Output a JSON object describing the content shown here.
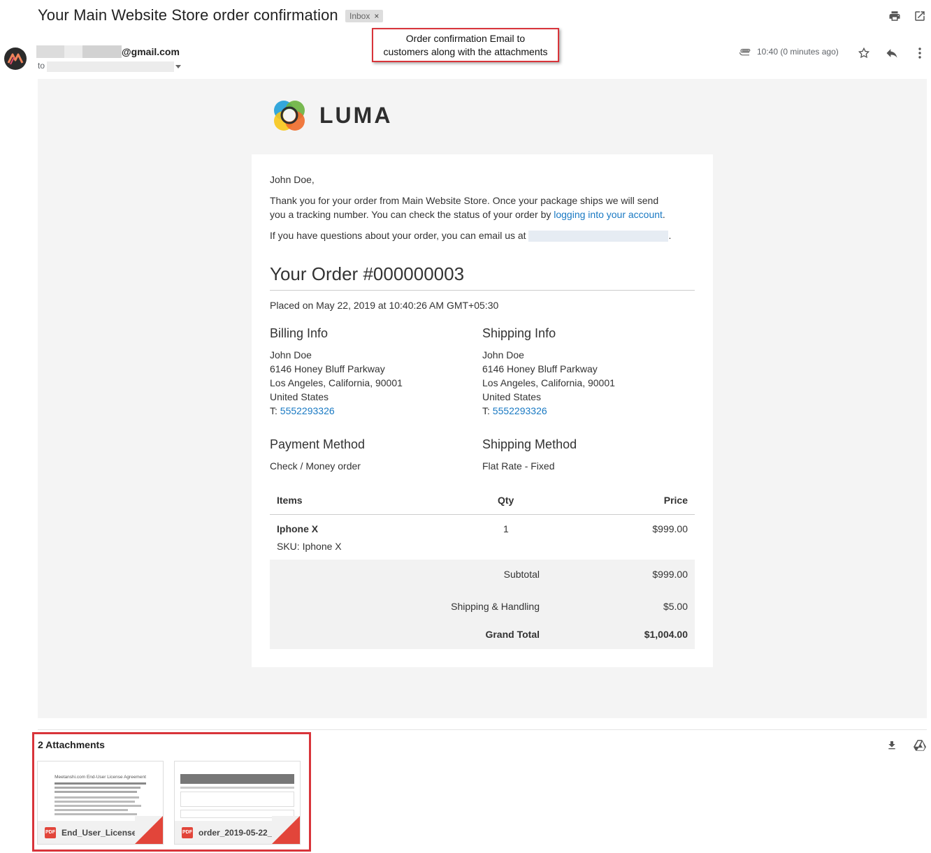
{
  "email": {
    "subject": "Your Main Website Store order confirmation",
    "label": "Inbox",
    "label_close": "×",
    "sender_domain": "@gmail.com",
    "to_label": "to",
    "time": "10:40 (0 minutes ago)"
  },
  "callout": {
    "line1": "Order confirmation Email to",
    "line2": "customers along with the attachments"
  },
  "store": {
    "logo_text": "LUMA"
  },
  "message": {
    "greeting": "John Doe,",
    "thanks_part1": "Thank you for your order from Main Website Store. Once your package ships we will send",
    "thanks_part2": "you a tracking number. You can check the status of your order by",
    "account_link": "logging into your account",
    "period": ".",
    "questions": "If you have questions about your order, you can email us at",
    "order_title": "Your Order #000000003",
    "placed_on": "Placed on May 22, 2019 at 10:40:26 AM GMT+05:30"
  },
  "billing": {
    "heading": "Billing Info",
    "name": "John Doe",
    "street": "6146 Honey Bluff Parkway",
    "city": "Los Angeles, California, 90001",
    "country": "United States",
    "phone_prefix": "T:",
    "phone": "5552293326"
  },
  "shipping": {
    "heading": "Shipping Info",
    "name": "John Doe",
    "street": "6146 Honey Bluff Parkway",
    "city": "Los Angeles, California, 90001",
    "country": "United States",
    "phone_prefix": "T:",
    "phone": "5552293326"
  },
  "payment": {
    "heading": "Payment Method",
    "value": "Check / Money order"
  },
  "shipping_method": {
    "heading": "Shipping Method",
    "value": "Flat Rate - Fixed"
  },
  "items_table": {
    "headers": {
      "items": "Items",
      "qty": "Qty",
      "price": "Price"
    },
    "rows": [
      {
        "name": "Iphone X",
        "sku": "SKU: Iphone X",
        "qty": "1",
        "price": "$999.00"
      }
    ],
    "subtotal_label": "Subtotal",
    "subtotal": "$999.00",
    "shipping_label": "Shipping & Handling",
    "shipping": "$5.00",
    "grand_total_label": "Grand Total",
    "grand_total": "$1,004.00"
  },
  "attachments": {
    "title": "2 Attachments",
    "files": [
      {
        "name": "End_User_License_...",
        "type": "PDF",
        "preview_title": "Meetanshi.com End-User License Agreement"
      },
      {
        "name": "order_2019-05-22_...",
        "type": "PDF"
      }
    ]
  },
  "icons": [
    "print-icon",
    "open-new-window-icon",
    "attachment-clip-icon",
    "star-icon",
    "reply-icon",
    "more-vert-icon",
    "download-all-icon",
    "drive-icon"
  ]
}
